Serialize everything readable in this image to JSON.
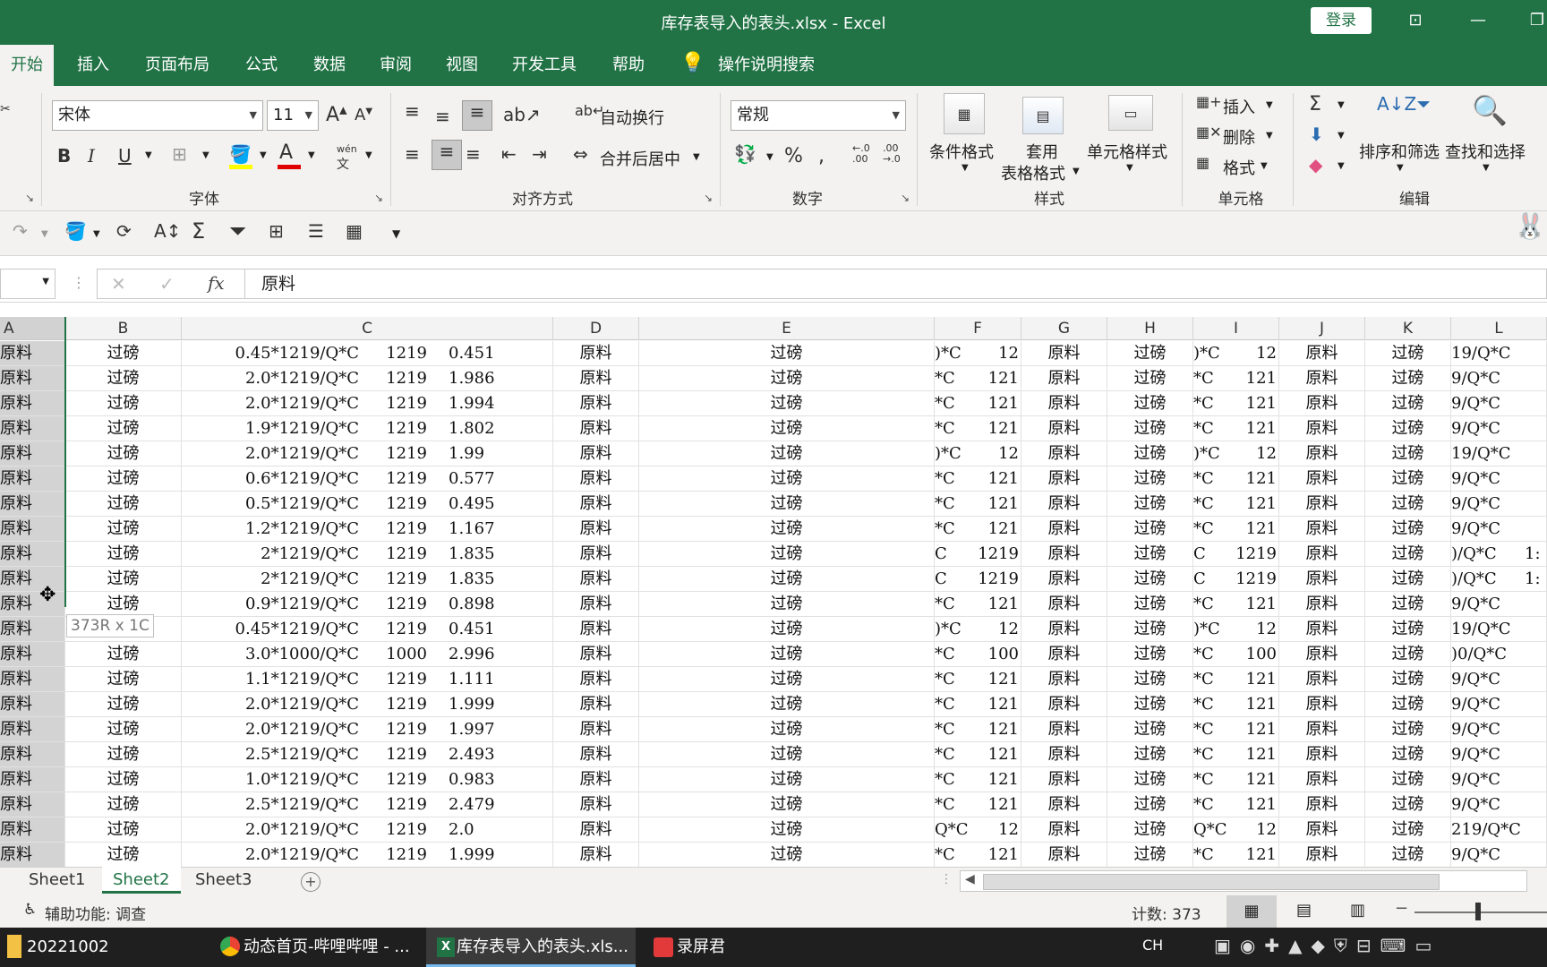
{
  "window": {
    "title": "库存表导入的表头.xlsx  -  Excel",
    "login": "登录"
  },
  "menu": {
    "tabs": [
      "开始",
      "插入",
      "页面布局",
      "公式",
      "数据",
      "审阅",
      "视图",
      "开发工具",
      "帮助"
    ],
    "tell_me": "操作说明搜索"
  },
  "ribbon": {
    "font_name": "宋体",
    "font_size": "11",
    "wrap_text": "自动换行",
    "merge_center": "合并后居中",
    "number_format": "常规",
    "conditional_format": "条件格式",
    "format_as_table_1": "套用",
    "format_as_table_2": "表格格式",
    "cell_styles": "单元格样式",
    "insert": "插入",
    "delete": "删除",
    "format": "格式",
    "sort_filter": "排序和筛选",
    "find_select": "查找和选择",
    "groups": {
      "font": "字体",
      "align": "对齐方式",
      "number": "数字",
      "styles": "样式",
      "cells": "单元格",
      "editing": "编辑"
    },
    "wen_label": "wén",
    "wen_char": "文"
  },
  "formula_bar": {
    "value": "原料",
    "fx": "fx"
  },
  "columns": [
    "A",
    "B",
    "C",
    "D",
    "E",
    "F",
    "G",
    "H",
    "I",
    "J",
    "K",
    "L"
  ],
  "rows": [
    {
      "a": "原料",
      "b": "过磅",
      "c1": "0.45*1219/Q*C",
      "c2": "1219",
      "c3": "0.451",
      "d": "原料",
      "e": "过磅",
      "f1": ")*C",
      "f2": "12",
      "g": "原料",
      "h": "过磅",
      "i1": ")*C",
      "i2": "12",
      "j": "原料",
      "k": "过磅",
      "l1": "19/Q*C",
      "l2": ""
    },
    {
      "a": "原料",
      "b": "过磅",
      "c1": "2.0*1219/Q*C",
      "c2": "1219",
      "c3": "1.986",
      "d": "原料",
      "e": "过磅",
      "f1": "*C",
      "f2": "121",
      "g": "原料",
      "h": "过磅",
      "i1": "*C",
      "i2": "121",
      "j": "原料",
      "k": "过磅",
      "l1": "9/Q*C",
      "l2": ""
    },
    {
      "a": "原料",
      "b": "过磅",
      "c1": "2.0*1219/Q*C",
      "c2": "1219",
      "c3": "1.994",
      "d": "原料",
      "e": "过磅",
      "f1": "*C",
      "f2": "121",
      "g": "原料",
      "h": "过磅",
      "i1": "*C",
      "i2": "121",
      "j": "原料",
      "k": "过磅",
      "l1": "9/Q*C",
      "l2": ""
    },
    {
      "a": "原料",
      "b": "过磅",
      "c1": "1.9*1219/Q*C",
      "c2": "1219",
      "c3": "1.802",
      "d": "原料",
      "e": "过磅",
      "f1": "*C",
      "f2": "121",
      "g": "原料",
      "h": "过磅",
      "i1": "*C",
      "i2": "121",
      "j": "原料",
      "k": "过磅",
      "l1": "9/Q*C",
      "l2": ""
    },
    {
      "a": "原料",
      "b": "过磅",
      "c1": "2.0*1219/Q*C",
      "c2": "1219",
      "c3": "1.99",
      "d": "原料",
      "e": "过磅",
      "f1": ")*C",
      "f2": "12",
      "g": "原料",
      "h": "过磅",
      "i1": ")*C",
      "i2": "12",
      "j": "原料",
      "k": "过磅",
      "l1": "19/Q*C",
      "l2": ""
    },
    {
      "a": "原料",
      "b": "过磅",
      "c1": "0.6*1219/Q*C",
      "c2": "1219",
      "c3": "0.577",
      "d": "原料",
      "e": "过磅",
      "f1": "*C",
      "f2": "121",
      "g": "原料",
      "h": "过磅",
      "i1": "*C",
      "i2": "121",
      "j": "原料",
      "k": "过磅",
      "l1": "9/Q*C",
      "l2": ""
    },
    {
      "a": "原料",
      "b": "过磅",
      "c1": "0.5*1219/Q*C",
      "c2": "1219",
      "c3": "0.495",
      "d": "原料",
      "e": "过磅",
      "f1": "*C",
      "f2": "121",
      "g": "原料",
      "h": "过磅",
      "i1": "*C",
      "i2": "121",
      "j": "原料",
      "k": "过磅",
      "l1": "9/Q*C",
      "l2": ""
    },
    {
      "a": "原料",
      "b": "过磅",
      "c1": "1.2*1219/Q*C",
      "c2": "1219",
      "c3": "1.167",
      "d": "原料",
      "e": "过磅",
      "f1": "*C",
      "f2": "121",
      "g": "原料",
      "h": "过磅",
      "i1": "*C",
      "i2": "121",
      "j": "原料",
      "k": "过磅",
      "l1": "9/Q*C",
      "l2": ""
    },
    {
      "a": "原料",
      "b": "过磅",
      "c1": "2*1219/Q*C",
      "c2": "1219",
      "c3": "1.835",
      "d": "原料",
      "e": "过磅",
      "f1": "C",
      "f2": "1219",
      "g": "原料",
      "h": "过磅",
      "i1": "C",
      "i2": "1219",
      "j": "原料",
      "k": "过磅",
      "l1": ")/Q*C",
      "l2": "1:"
    },
    {
      "a": "原料",
      "b": "过磅",
      "c1": "2*1219/Q*C",
      "c2": "1219",
      "c3": "1.835",
      "d": "原料",
      "e": "过磅",
      "f1": "C",
      "f2": "1219",
      "g": "原料",
      "h": "过磅",
      "i1": "C",
      "i2": "1219",
      "j": "原料",
      "k": "过磅",
      "l1": ")/Q*C",
      "l2": "1:"
    },
    {
      "a": "原料",
      "b": "过磅",
      "c1": "0.9*1219/Q*C",
      "c2": "1219",
      "c3": "0.898",
      "d": "原料",
      "e": "过磅",
      "f1": "*C",
      "f2": "121",
      "g": "原料",
      "h": "过磅",
      "i1": "*C",
      "i2": "121",
      "j": "原料",
      "k": "过磅",
      "l1": "9/Q*C",
      "l2": ""
    },
    {
      "a": "原料",
      "b": "",
      "c1": "0.45*1219/Q*C",
      "c2": "1219",
      "c3": "0.451",
      "d": "原料",
      "e": "过磅",
      "f1": ")*C",
      "f2": "12",
      "g": "原料",
      "h": "过磅",
      "i1": ")*C",
      "i2": "12",
      "j": "原料",
      "k": "过磅",
      "l1": "19/Q*C",
      "l2": ""
    },
    {
      "a": "原料",
      "b": "过磅",
      "c1": "3.0*1000/Q*C",
      "c2": "1000",
      "c3": "2.996",
      "d": "原料",
      "e": "过磅",
      "f1": "*C",
      "f2": "100",
      "g": "原料",
      "h": "过磅",
      "i1": "*C",
      "i2": "100",
      "j": "原料",
      "k": "过磅",
      "l1": ")0/Q*C",
      "l2": ""
    },
    {
      "a": "原料",
      "b": "过磅",
      "c1": "1.1*1219/Q*C",
      "c2": "1219",
      "c3": "1.111",
      "d": "原料",
      "e": "过磅",
      "f1": "*C",
      "f2": "121",
      "g": "原料",
      "h": "过磅",
      "i1": "*C",
      "i2": "121",
      "j": "原料",
      "k": "过磅",
      "l1": "9/Q*C",
      "l2": ""
    },
    {
      "a": "原料",
      "b": "过磅",
      "c1": "2.0*1219/Q*C",
      "c2": "1219",
      "c3": "1.999",
      "d": "原料",
      "e": "过磅",
      "f1": "*C",
      "f2": "121",
      "g": "原料",
      "h": "过磅",
      "i1": "*C",
      "i2": "121",
      "j": "原料",
      "k": "过磅",
      "l1": "9/Q*C",
      "l2": ""
    },
    {
      "a": "原料",
      "b": "过磅",
      "c1": "2.0*1219/Q*C",
      "c2": "1219",
      "c3": "1.997",
      "d": "原料",
      "e": "过磅",
      "f1": "*C",
      "f2": "121",
      "g": "原料",
      "h": "过磅",
      "i1": "*C",
      "i2": "121",
      "j": "原料",
      "k": "过磅",
      "l1": "9/Q*C",
      "l2": ""
    },
    {
      "a": "原料",
      "b": "过磅",
      "c1": "2.5*1219/Q*C",
      "c2": "1219",
      "c3": "2.493",
      "d": "原料",
      "e": "过磅",
      "f1": "*C",
      "f2": "121",
      "g": "原料",
      "h": "过磅",
      "i1": "*C",
      "i2": "121",
      "j": "原料",
      "k": "过磅",
      "l1": "9/Q*C",
      "l2": ""
    },
    {
      "a": "原料",
      "b": "过磅",
      "c1": "1.0*1219/Q*C",
      "c2": "1219",
      "c3": "0.983",
      "d": "原料",
      "e": "过磅",
      "f1": "*C",
      "f2": "121",
      "g": "原料",
      "h": "过磅",
      "i1": "*C",
      "i2": "121",
      "j": "原料",
      "k": "过磅",
      "l1": "9/Q*C",
      "l2": ""
    },
    {
      "a": "原料",
      "b": "过磅",
      "c1": "2.5*1219/Q*C",
      "c2": "1219",
      "c3": "2.479",
      "d": "原料",
      "e": "过磅",
      "f1": "*C",
      "f2": "121",
      "g": "原料",
      "h": "过磅",
      "i1": "*C",
      "i2": "121",
      "j": "原料",
      "k": "过磅",
      "l1": "9/Q*C",
      "l2": ""
    },
    {
      "a": "原料",
      "b": "过磅",
      "c1": "2.0*1219/Q*C",
      "c2": "1219",
      "c3": "2.0",
      "d": "原料",
      "e": "过磅",
      "f1": "Q*C",
      "f2": "12",
      "g": "原料",
      "h": "过磅",
      "i1": "Q*C",
      "i2": "12",
      "j": "原料",
      "k": "过磅",
      "l1": "219/Q*C",
      "l2": ""
    },
    {
      "a": "原料",
      "b": "过磅",
      "c1": "2.0*1219/Q*C",
      "c2": "1219",
      "c3": "1.999",
      "d": "原料",
      "e": "过磅",
      "f1": "*C",
      "f2": "121",
      "g": "原料",
      "h": "过磅",
      "i1": "*C",
      "i2": "121",
      "j": "原料",
      "k": "过磅",
      "l1": "9/Q*C",
      "l2": ""
    }
  ],
  "selection_tooltip": "373R x 1C",
  "sheets": [
    "Sheet1",
    "Sheet2",
    "Sheet3"
  ],
  "active_sheet": "Sheet2",
  "status": {
    "accessibility": "辅助功能: 调查",
    "count": "计数: 373"
  },
  "taskbar": {
    "folder": "20221002",
    "browser": "动态首页-哔哩哔哩 - ...",
    "excel": "库存表导入的表头.xls...",
    "recorder": "录屏君",
    "ime": "CH"
  },
  "colors": {
    "excel_green": "#217346",
    "ribbon_bg": "#f3f2f1",
    "selected_cell": "#d3d3d3"
  }
}
